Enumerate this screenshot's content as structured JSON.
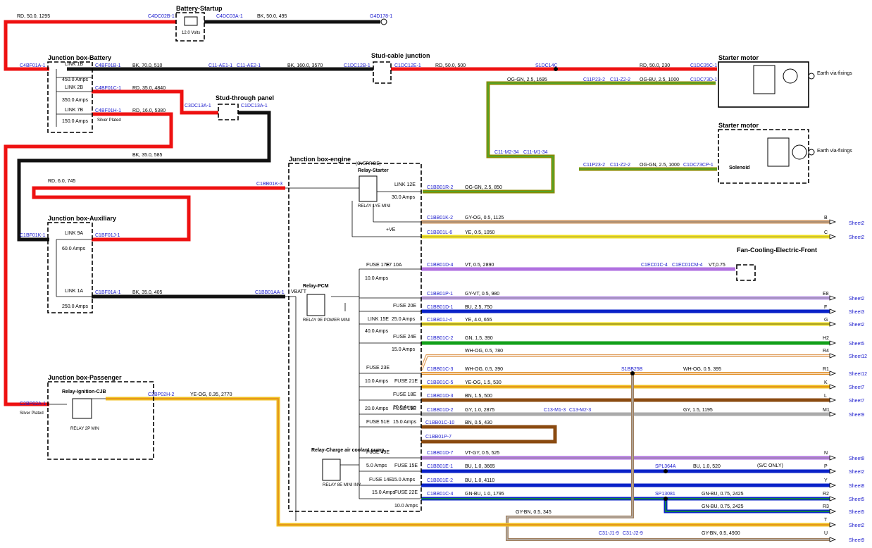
{
  "boxes": {
    "battery_startup": "Battery-Startup",
    "jb_battery": "Junction box-Battery",
    "stud_cable": "Stud-cable junction",
    "stud_through": "Stud-through panel",
    "starter1": "Starter motor",
    "starter2": "Starter motor",
    "jb_engine": "Junction box-engine",
    "jb_aux": "Junction box-Auxiliary",
    "fan": "Fan-Cooling-Electric-Front",
    "jb_passenger": "Junction box-Passenger",
    "relay_pcm": "Relay-PCM",
    "relay_ignition": "Relay-Ignition-CJB",
    "relay_charge": "Relay-Charge air coolant pump",
    "relay_starter": "Relay-Starter",
    "solenoid": "Solenoid"
  },
  "small_text": {
    "volts": "12.0 Volts",
    "silver_plated": "Silver Plated",
    "silver_plated2": "Silver Plated",
    "earth1": "Earth via-fixings",
    "earth2": "Earth via-fixings",
    "override": "(OVERRIDE)",
    "relay_1ye": "RELAY 1YE MINI",
    "relay_9e": "RELAY 9E POWER MINI",
    "relay_2p": "RELAY 2P MIN",
    "relay_8e": "RELAY 8E MINI INV",
    "vbatt": "VBATT",
    "plus_ve": "+VE",
    "sc_only": "(S/C ONLY)"
  },
  "links": {
    "l1b": "LINK 1B",
    "l1b_a": "450.0 Amps",
    "l2b": "LINK 2B",
    "l2b_a": "350.0 Amps",
    "l7b": "LINK 7B",
    "l7b_a": "150.0 Amps",
    "l9a": "LINK 9A",
    "l9a_a": "60.0 Amps",
    "l1a": "LINK 1A",
    "l1a_a": "250.0 Amps",
    "l12e": "LINK 12E",
    "l12e_a": "30.0 Amps",
    "l15e": "LINK 15E",
    "l15e_a": "40.0 Amps"
  },
  "fuses": {
    "f17e": "FUSE 17E",
    "f17e_a": "10.0 Amps",
    "f7": "F7 10A",
    "f20e": "FUSE 20E",
    "f20e_a": "25.0 Amps",
    "f24e": "FUSE 24E",
    "f24e_a": "15.0 Amps",
    "f23e": "FUSE 23E",
    "f23e_a": "10.0 Amps",
    "f21e": "FUSE 21E",
    "f18e": "FUSE 18E",
    "f18e_a": "20.0 Amps",
    "f19e": "FUSE 19E",
    "f19e_a": "20.0 Amps",
    "f51e": "FUSE 51E",
    "f51e_a": "15.0 Amps",
    "f49e": "FUSE 49E",
    "f49e_a": "5.0 Amps",
    "f15e": "FUSE 15E",
    "f14e": "FUSE 14E",
    "f14e_a": "15.0 Amps",
    "f22e": "FUSE 22E",
    "f22e_a": "15.0 Amps",
    "f22e_b": "10.0 Amps"
  },
  "connectors": {
    "c4dc02b": "C4DC02B-1",
    "c4dc03a": "C4DC03A-1",
    "g4d178": "G4D178-1",
    "c4bf01a": "C4BF01A-1",
    "c4bf01b": "C4BF01B-1",
    "c11ae1": "C11-AE1-1",
    "c11ae2": "C11-AE2-1",
    "c1dc12b": "C1DC12B-1",
    "c1dc12e": "C1DC12E-1",
    "s1dc14c": "S1DC14C",
    "c1dc35c": "C1DC35C-1",
    "c4bf01c": "C4BF01C-1",
    "c3dc13a": "C3DC13A-1",
    "c1dc13a": "C1DC13A-1",
    "c11p23": "C11P23-2",
    "c11z2": "C11-Z2-2",
    "c1dc73d": "C1DC73D-1",
    "c4bf01h": "C4BF01H-1",
    "c11m234": "C11-M2-34",
    "c11m134": "C11-M1-34",
    "c11p23b": "C11P23-2",
    "c11z2b": "C11-Z2-2",
    "c1dc73cp": "C1DC73CP-1",
    "c1bb01k3": "C1BB01K-3",
    "c1bb01r2": "C1BB01R-2",
    "c1bb01k2": "C1BB01K-2",
    "c1bb01l6": "C1BB01L-6",
    "c1bf01k": "C1BF01K-1",
    "c1bf01j": "C1BF01J-1",
    "c1bb01d4": "C1BB01D-4",
    "c1ec01c4": "C1EC01C-4",
    "c1ec01cm4": "C1EC01CM-4",
    "c1bf01a": "C1BF01A-1",
    "c1bb01aa": "C1BB01AA-1",
    "c1bb01p1": "C1BB01P-1",
    "c1bb01d1": "C1BB01D-1",
    "c1bb01j4": "C1BB01J-4",
    "c1bb01c2": "C1BB01C-2",
    "c1bb01c3": "C1BB01C-3",
    "s1bb25b": "S1BB25B",
    "c1bb01c5": "C1BB01C-5",
    "c1bb01d3": "C1BB01D-3",
    "c2bp02a": "C2BP02A-1",
    "c2bp02h": "C2BP02H-2",
    "c1bb01d2": "C1BB01D-2",
    "c13m13": "C13-M1-3",
    "c13m23": "C13-M2-3",
    "c1bb01c10": "C1BB01C-10",
    "c1bb01p7": "C1BB01P-7",
    "c1bb01d7": "C1BB01D-7",
    "c1bb01e1": "C1BB01E-1",
    "spl364a": "SPL364A",
    "c1bb01e2": "C1BB01E-2",
    "c1bb01c4": "C1BB01C-4",
    "sp13081": "SP13081",
    "c31j19": "C31-J1-9",
    "c31j29": "C31-J2-9"
  },
  "wires": {
    "w1": "RD, 50.0, 1295",
    "w2": "BK, 50.0, 495",
    "w3": "BK, 70.0, 510",
    "w4": "BK, 160.0, 3570",
    "w5": "RD, 50.0, 500",
    "w6": "RD, 50.0, 230",
    "w7": "OG-GN, 2.5, 1695",
    "w8": "OG-BU, 2.5, 1000",
    "w9": "RD, 35.0, 4840",
    "w10": "RD, 16.0, 5380",
    "w11": "BK, 35.0, 585",
    "w12": "OG-GN, 2.5, 1000",
    "w13": "RD, 6.0, 745",
    "w14": "OG-GN, 2.5, 850",
    "w15": "GY-OG, 0.5, 1125",
    "w16": "YE, 0.5, 1050",
    "w17": "VT, 0.5, 2890",
    "w17b": "VT,0.75",
    "w18": "BK, 35.0, 405",
    "w19": "GY-VT, 0.5, 980",
    "w20": "BU, 2.5, 750",
    "w21": "YE, 4.0, 655",
    "w22": "GN, 1.5, 390",
    "w23": "WH-OG, 0.5, 780",
    "w24": "WH-OG, 0.5, 390",
    "w25": "WH-OG, 0.5, 395",
    "w26": "YE-OG, 1.5, 530",
    "w27": "BN, 1.5, 500",
    "w28": "YE-OG, 0.35, 2770",
    "w29": "GY, 1.0, 2875",
    "w30": "GY, 1.5, 1195",
    "w31": "BN, 0.5, 430",
    "w32": "VT-GY, 0.5, 525",
    "w33": "BU, 1.0, 3665",
    "w34": "BU, 1.0, 520",
    "w35": "BU, 1.0, 4110",
    "w36": "GN-BU, 1.0, 1795",
    "w37": "GN-BU, 0.75, 2425",
    "w38": "GN-BU, 0.75, 2425",
    "w39": "GY-BN, 0.5, 345",
    "w40": "GY-BN, 0.5, 4900"
  },
  "right_codes": {
    "b": "B",
    "c": "C",
    "e8": "E8",
    "f": "F",
    "g": "G",
    "h2": "H2",
    "r4": "R4",
    "r1": "R1",
    "k": "K",
    "l": "L",
    "m1": "M1",
    "n": "N",
    "p": "P",
    "y": "Y",
    "r2": "R2",
    "r3": "R3",
    "t": "T",
    "u": "U"
  },
  "sheet_refs": [
    "Sheet2",
    "Sheet2",
    "Sheet2",
    "Sheet3",
    "Sheet2",
    "Sheet5",
    "Sheet12",
    "Sheet12",
    "Sheet7",
    "Sheet7",
    "Sheet9",
    "Sheet8",
    "Sheet2",
    "Sheet8",
    "Sheet5",
    "Sheet5",
    "Sheet2",
    "Sheet9"
  ],
  "colors": {
    "red": "#ee1111",
    "black": "#111111",
    "olive": "#8a8a00",
    "olive_stripe": "#44aa33",
    "tan": "#d09a66",
    "yellow": "#f0e020",
    "violet": "#b070e0",
    "blue": "#0a22c8",
    "green": "#12a01a",
    "orange": "#e08a1e",
    "brown": "#8a4a10",
    "grey": "#aaaaaa",
    "connector_blue": "#1a1acc"
  }
}
